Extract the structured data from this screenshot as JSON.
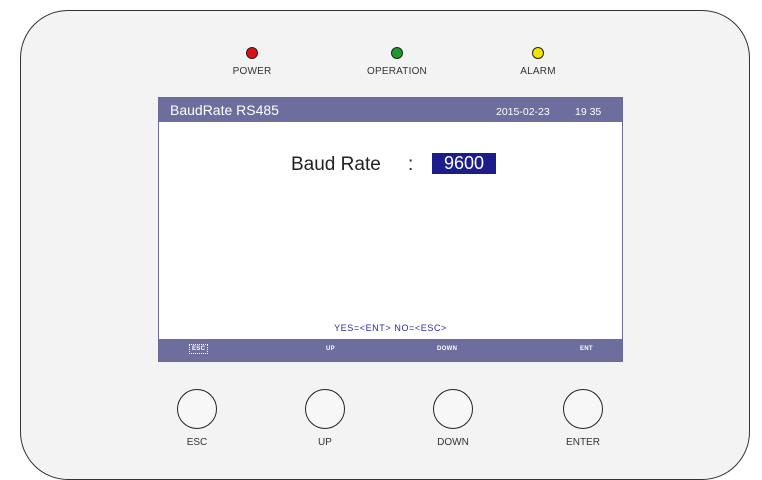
{
  "indicators": [
    {
      "label": "POWER",
      "color": "#e01010"
    },
    {
      "label": "OPERATION",
      "color": "#1c9a2c"
    },
    {
      "label": "ALARM",
      "color": "#f2e400"
    }
  ],
  "screen": {
    "title": "BaudRate RS485",
    "date": "2015-02-23",
    "time": "19 35",
    "field_label": "Baud Rate",
    "field_colon": ":",
    "field_value": "9600",
    "confirm_text": "YES=<ENT>  NO=<ESC>",
    "softkeys": {
      "esc": "ESC",
      "up": "UP",
      "down": "DOWN",
      "ent": "ENT"
    }
  },
  "buttons": {
    "esc": "ESC",
    "up": "UP",
    "down": "DOWN",
    "enter": "ENTER"
  }
}
